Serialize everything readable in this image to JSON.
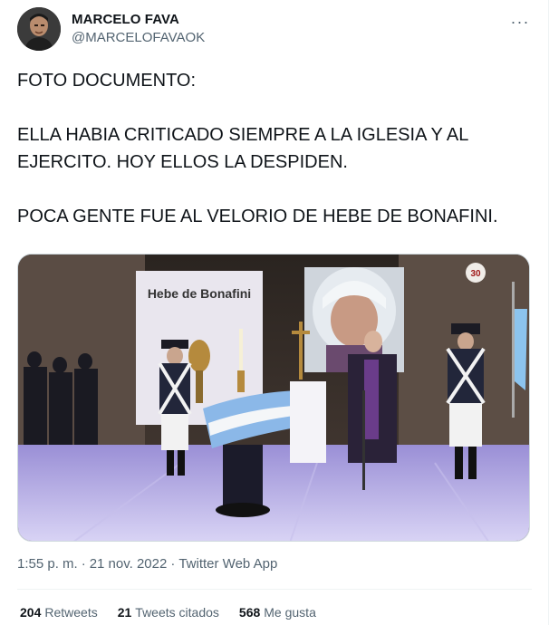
{
  "author": {
    "display_name": "MARCELO FAVA",
    "handle": "@MARCELOFAVAOK"
  },
  "menu_icon": "more-horizontal-icon",
  "tweet": {
    "lines": [
      "FOTO DOCUMENTO:",
      "ELLA HABIA CRITICADO SIEMPRE A LA IGLESIA Y AL EJERCITO. HOY ELLOS LA DESPIDEN.",
      "POCA GENTE FUE AL VELORIO DE HEBE DE BONAFINI."
    ]
  },
  "photo": {
    "banner_text": "Hebe de Bonafini",
    "logo_text": "30",
    "logo_subtext": "años"
  },
  "meta": {
    "time": "1:55 p. m.",
    "separator_1": "·",
    "date": "21 nov. 2022",
    "separator_2": "·",
    "source": "Twitter Web App"
  },
  "stats": {
    "retweets_count": "204",
    "retweets_label": "Retweets",
    "quotes_count": "21",
    "quotes_label": "Tweets citados",
    "likes_count": "568",
    "likes_label": "Me gusta"
  },
  "colors": {
    "text": "#0f1419",
    "secondary": "#536471",
    "border": "#eff3f4"
  }
}
